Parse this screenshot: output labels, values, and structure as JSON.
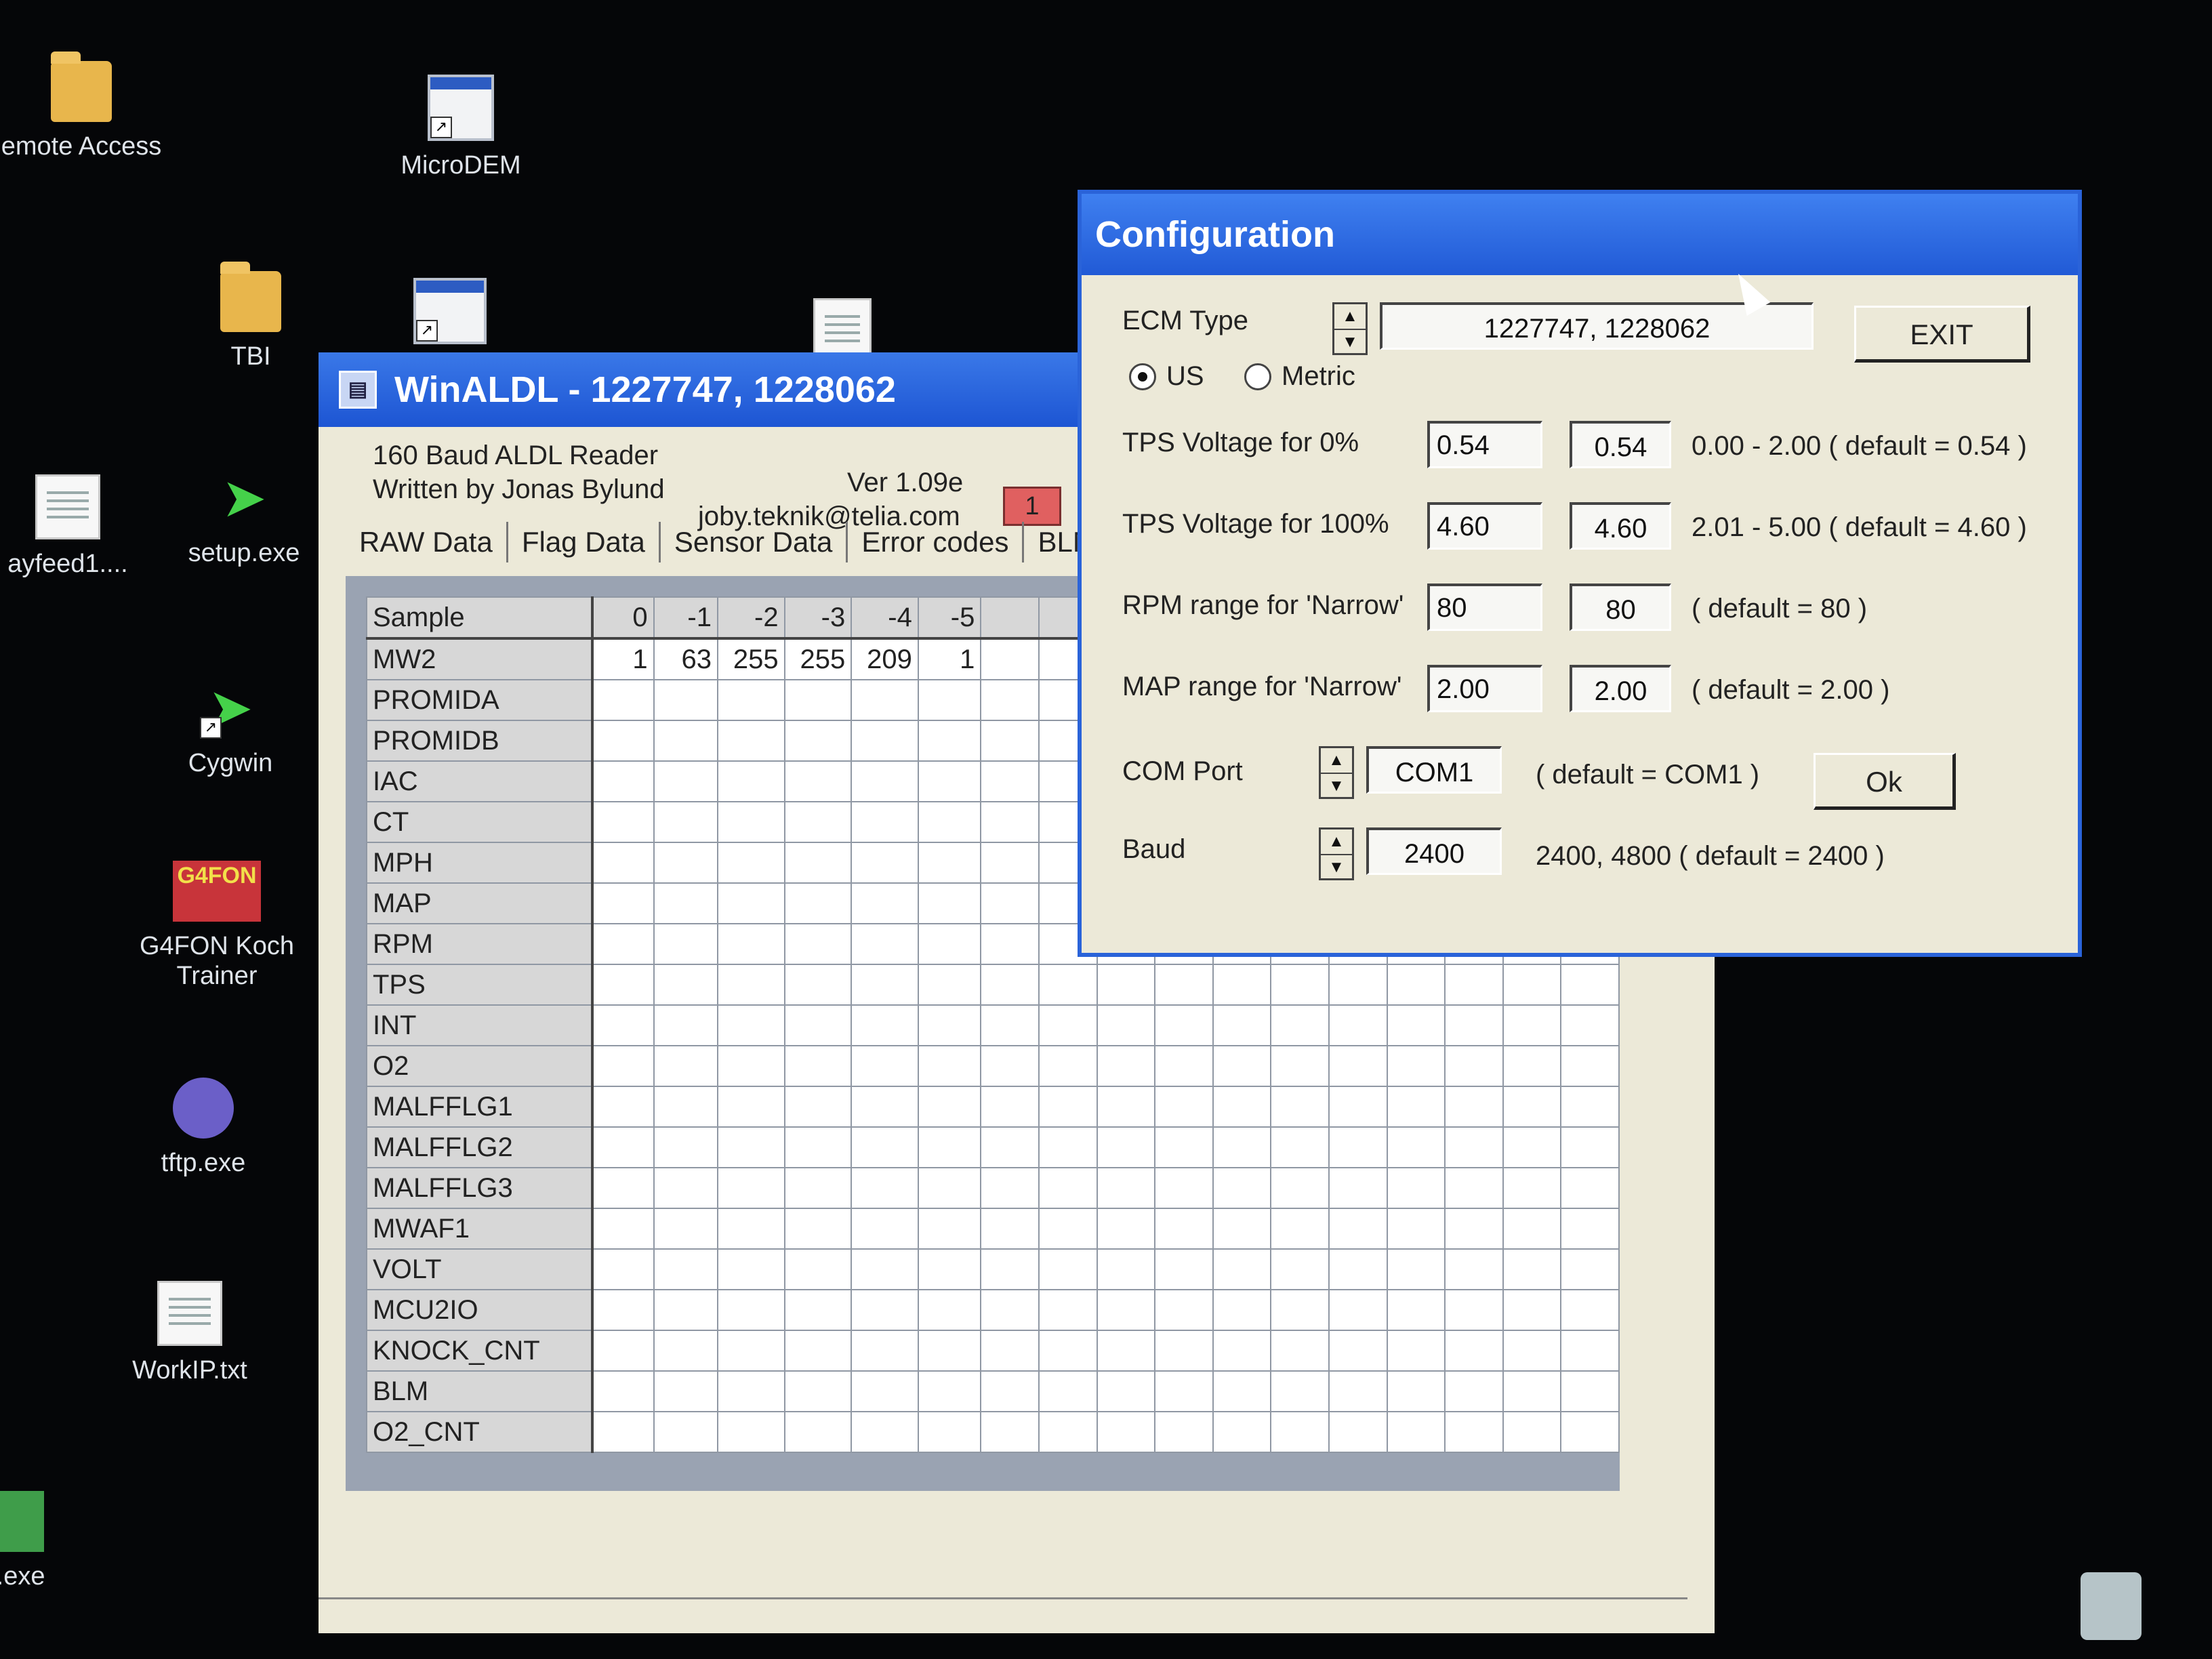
{
  "desktop": {
    "icons": [
      {
        "label": "emote Access"
      },
      {
        "label": "MicroDEM"
      },
      {
        "label": "TBI"
      },
      {
        "label": "ayfeed1...."
      },
      {
        "label": "setup.exe"
      },
      {
        "label": "Cygwin"
      },
      {
        "label": "G4FON Koch Trainer"
      },
      {
        "label": "tftp.exe"
      },
      {
        "label": "WorkIP.txt"
      },
      {
        "label": "g.exe"
      }
    ],
    "g4fon_logo": "G4FON"
  },
  "winaldl": {
    "title": "WinALDL - 1227747, 1228062",
    "subtitle": "160 Baud ALDL Reader",
    "author": "Written by Jonas Bylund",
    "version": "Ver 1.09e",
    "email": "joby.teknik@telia.com",
    "status_value": "1",
    "tabs": [
      "RAW Data",
      "Flag Data",
      "Sensor Data",
      "Error codes",
      "BLM"
    ],
    "table": {
      "header_label": "Sample",
      "columns": [
        "0",
        "-1",
        "-2",
        "-3",
        "-4",
        "-5"
      ],
      "rows": [
        {
          "label": "MW2",
          "values": [
            "1",
            "63",
            "255",
            "255",
            "209",
            "1"
          ]
        },
        {
          "label": "PROMIDA"
        },
        {
          "label": "PROMIDB"
        },
        {
          "label": "IAC"
        },
        {
          "label": "CT"
        },
        {
          "label": "MPH"
        },
        {
          "label": "MAP"
        },
        {
          "label": "RPM"
        },
        {
          "label": "TPS"
        },
        {
          "label": "INT"
        },
        {
          "label": "O2"
        },
        {
          "label": "MALFFLG1"
        },
        {
          "label": "MALFFLG2"
        },
        {
          "label": "MALFFLG3"
        },
        {
          "label": "MWAF1"
        },
        {
          "label": "VOLT"
        },
        {
          "label": "MCU2IO"
        },
        {
          "label": "KNOCK_CNT"
        },
        {
          "label": "BLM"
        },
        {
          "label": "O2_CNT"
        }
      ]
    }
  },
  "config": {
    "title": "Configuration",
    "ecm_label": "ECM Type",
    "ecm_value": "1227747, 1228062",
    "exit_label": "EXIT",
    "units": {
      "us": "US",
      "metric": "Metric",
      "selected": "US"
    },
    "tps0": {
      "label": "TPS Voltage for 0%",
      "input": "0.54",
      "current": "0.54",
      "hint": "0.00 - 2.00 ( default = 0.54 )"
    },
    "tps100": {
      "label": "TPS Voltage for 100%",
      "input": "4.60",
      "current": "4.60",
      "hint": "2.01 - 5.00 ( default = 4.60 )"
    },
    "rpm": {
      "label": "RPM range for 'Narrow'",
      "input": "80",
      "current": "80",
      "hint": "( default = 80 )"
    },
    "map": {
      "label": "MAP range for 'Narrow'",
      "input": "2.00",
      "current": "2.00",
      "hint": "( default = 2.00 )"
    },
    "com": {
      "label": "COM Port",
      "value": "COM1",
      "hint": "( default = COM1 )"
    },
    "ok_label": "Ok",
    "baud": {
      "label": "Baud",
      "value": "2400",
      "hint": "2400, 4800  ( default = 2400 )"
    }
  }
}
